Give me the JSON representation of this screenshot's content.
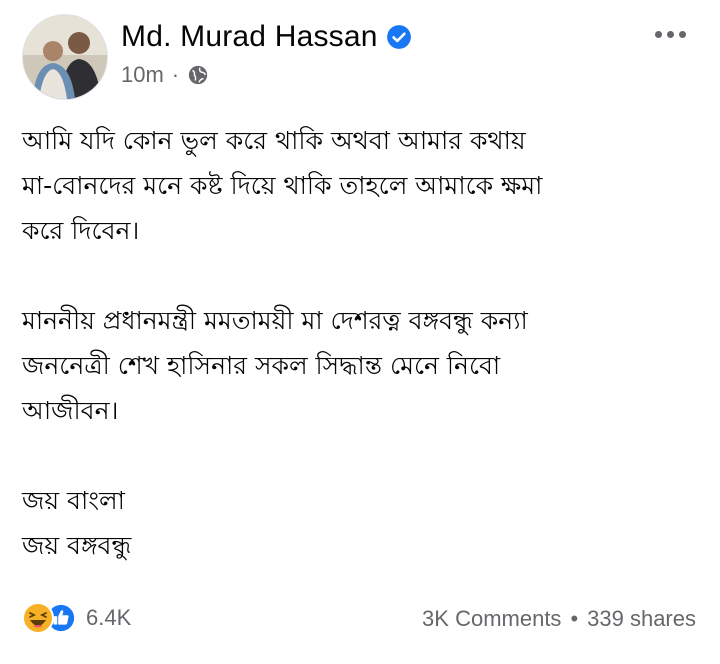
{
  "post": {
    "author_name": "Md. Murad Hassan",
    "timestamp": "10m",
    "separator": "·",
    "paragraphs": [
      [
        "আমি যদি কোন ভুল করে থাকি অথবা আমার কথায়",
        "মা-বোনদের মনে কষ্ট দিয়ে থাকি তাহলে আমাকে ক্ষমা",
        "করে দিবেন।"
      ],
      [
        "মাননীয় প্রধানমন্ত্রী মমতাময়ী মা দেশরত্ন বঙ্গবন্ধু কন্যা",
        "জননেত্রী শেখ হাসিনার সকল সিদ্ধান্ত মেনে নিবো",
        "আজীবন।"
      ],
      [
        "জয় বাংলা",
        "জয় বঙ্গবন্ধু"
      ]
    ]
  },
  "engagement": {
    "reaction_count": "6.4K",
    "comments": "3K Comments",
    "dot": "•",
    "shares": "339 shares"
  },
  "colors": {
    "verified": "#1877f2",
    "like": "#1877f2",
    "haha": "#f7b125",
    "secondary_text": "#65676b"
  },
  "icons": [
    "verified-badge-icon",
    "globe-icon",
    "more-options-icon",
    "haha-reaction-icon",
    "like-reaction-icon"
  ]
}
